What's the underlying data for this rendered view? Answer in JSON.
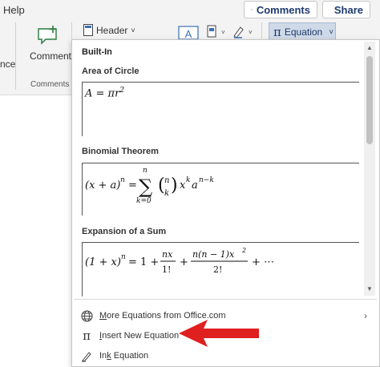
{
  "topbar": {
    "help_label": "Help",
    "comments_button": "Comments",
    "share_button": "Share"
  },
  "ribbon": {
    "left_edge_text": "nce",
    "comment_label": "Comment",
    "comments_group_label": "Comments",
    "header_label": "Header",
    "equation_label": "Equation"
  },
  "gallery": {
    "section_heading": "Built-In",
    "equations": [
      {
        "title": "Area of Circle"
      },
      {
        "title": "Binomial Theorem"
      },
      {
        "title": "Expansion of a Sum"
      }
    ]
  },
  "menu": {
    "more_equations": {
      "accel": "M",
      "rest": "ore Equations from Office.com"
    },
    "insert_new": {
      "accel": "I",
      "rest": "nsert New Equation"
    },
    "ink_equation": {
      "pre": "In",
      "accel": "k",
      "rest": " Equation"
    }
  },
  "colors": {
    "accent_blue": "#1e3a6e",
    "equation_button_bg": "#cfd9e8",
    "annotation_arrow": "#e01f1f"
  },
  "icons": [
    "comment-plus-icon",
    "header-icon",
    "text-box-icon",
    "quick-parts-icon",
    "signature-icon",
    "pi-icon",
    "globe-icon",
    "chevron-right-icon",
    "ink-icon",
    "chevron-down-icon"
  ]
}
